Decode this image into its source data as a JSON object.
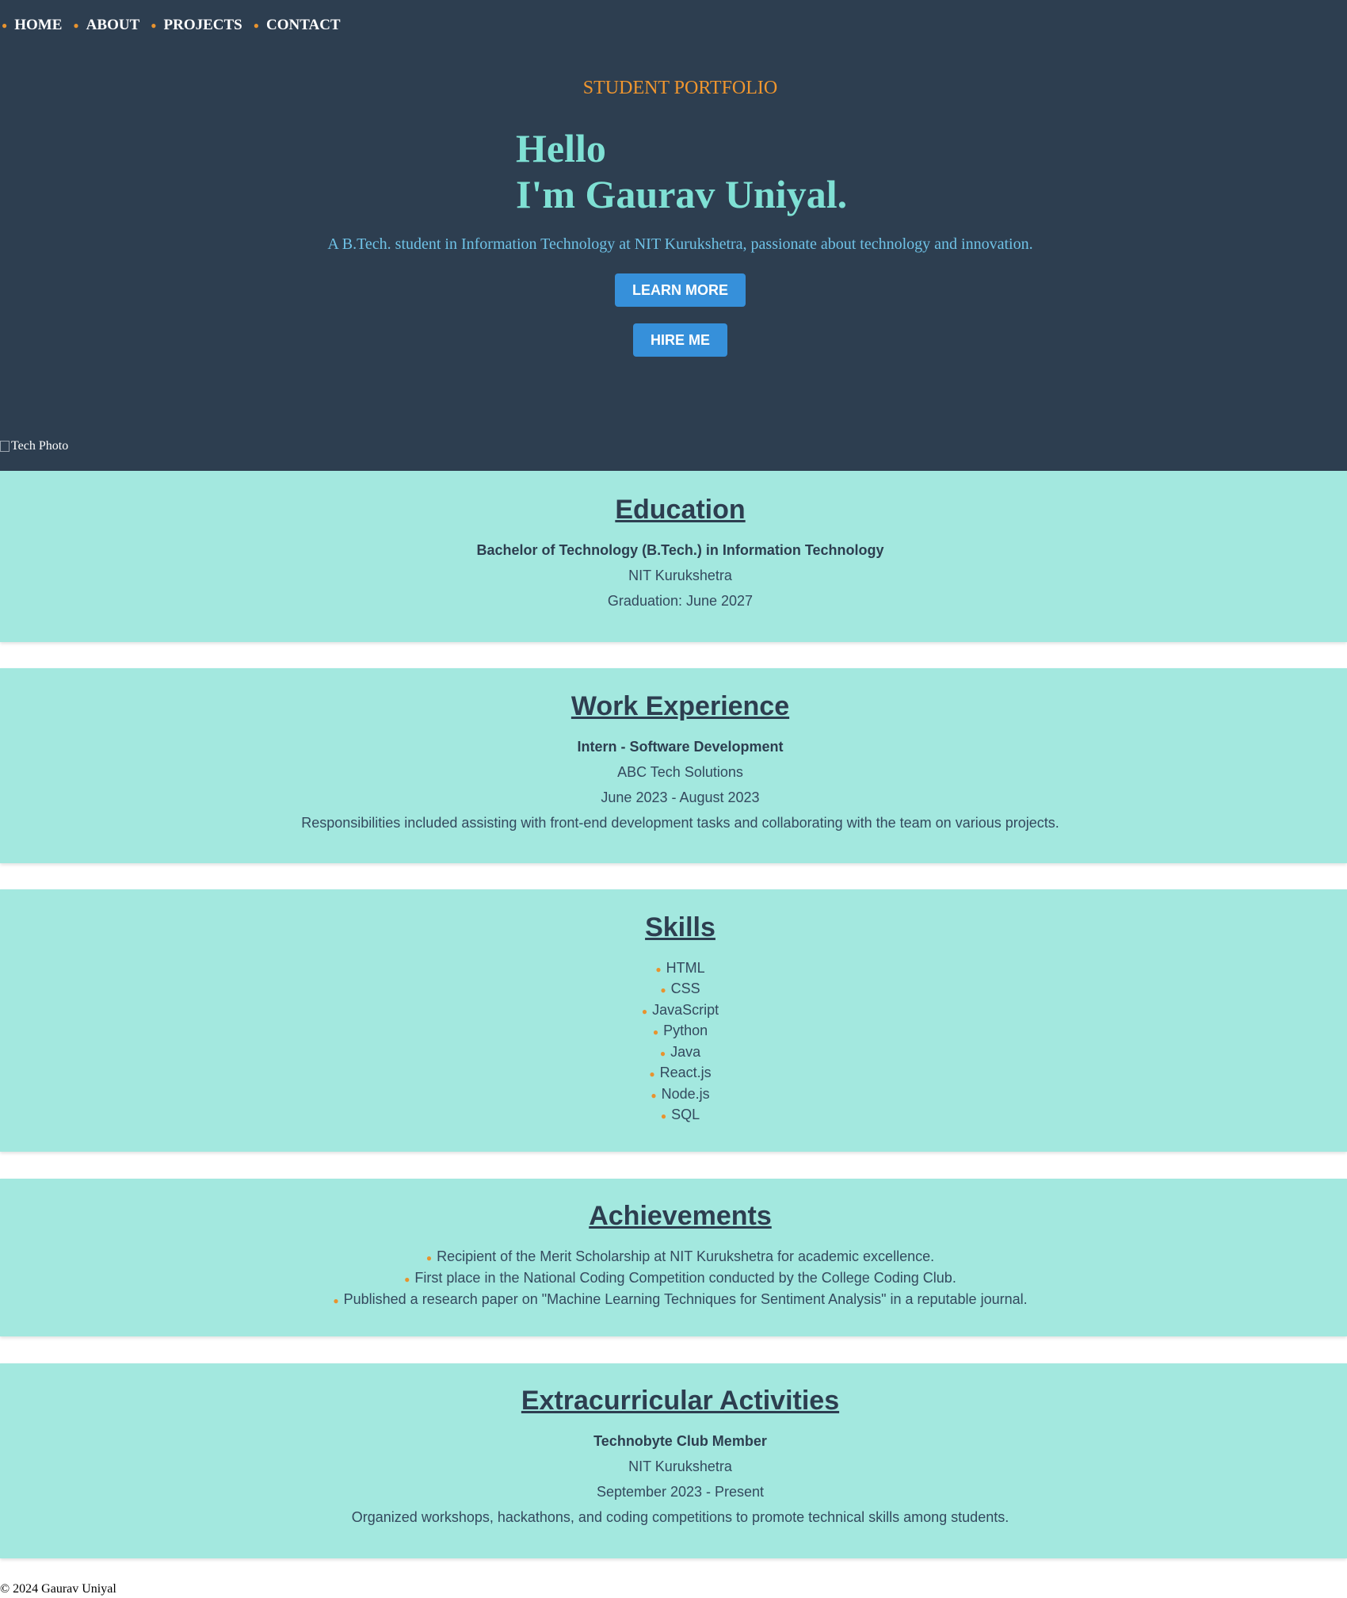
{
  "nav": [
    {
      "label": "HOME"
    },
    {
      "label": "ABOUT"
    },
    {
      "label": "PROJECTS"
    },
    {
      "label": "CONTACT"
    }
  ],
  "hero": {
    "eyebrow": "STUDENT PORTFOLIO",
    "greeting_line1": "Hello",
    "greeting_line2": "I'm Gaurav Uniyal.",
    "tagline": "A B.Tech. student in Information Technology at NIT Kurukshetra, passionate about technology and innovation.",
    "learn_more": "LEARN MORE",
    "hire_me": "HIRE ME",
    "photo_alt": "Tech Photo"
  },
  "education": {
    "title": "Education",
    "degree": "Bachelor of Technology (B.Tech.) in Information Technology",
    "institution": "NIT Kurukshetra",
    "graduation": "Graduation: June 2027"
  },
  "work": {
    "title": "Work Experience",
    "role": "Intern - Software Development",
    "company": "ABC Tech Solutions",
    "period": "June 2023 - August 2023",
    "description": "Responsibilities included assisting with front-end development tasks and collaborating with the team on various projects."
  },
  "skills": {
    "title": "Skills",
    "items": [
      "HTML",
      "CSS",
      "JavaScript",
      "Python",
      "Java",
      "React.js",
      "Node.js",
      "SQL"
    ]
  },
  "achievements": {
    "title": "Achievements",
    "items": [
      "Recipient of the Merit Scholarship at NIT Kurukshetra for academic excellence.",
      "First place in the National Coding Competition conducted by the College Coding Club.",
      "Published a research paper on \"Machine Learning Techniques for Sentiment Analysis\" in a reputable journal."
    ]
  },
  "extracurricular": {
    "title": "Extracurricular Activities",
    "role": "Technobyte Club Member",
    "institution": "NIT Kurukshetra",
    "period": "September 2023 - Present",
    "description": "Organized workshops, hackathons, and coding competitions to promote technical skills among students."
  },
  "footer": {
    "text": "© 2024 Gaurav Uniyal"
  },
  "colors": {
    "hero_bg": "#2d3e50",
    "accent_orange": "#f0962e",
    "heading_teal": "#7fe0d4",
    "button_blue": "#3690da",
    "card_bg": "#a3e8df"
  }
}
